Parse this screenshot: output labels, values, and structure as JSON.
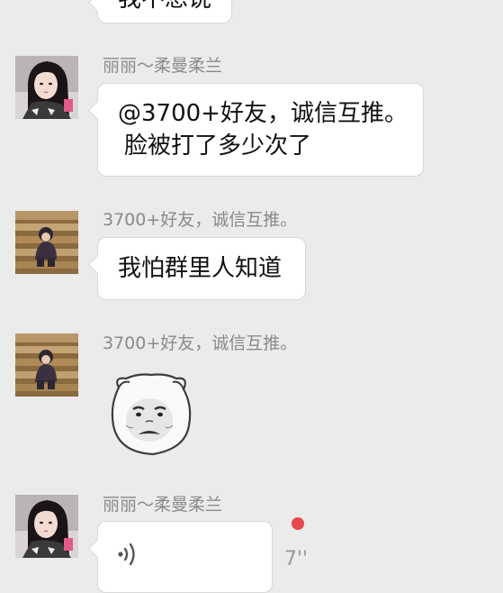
{
  "chat": {
    "messages": [
      {
        "type": "text",
        "lines": [
          "我不想说"
        ]
      },
      {
        "type": "text",
        "sender": "丽丽～柔曼柔兰",
        "avatar_icon": "girl-avatar-icon",
        "lines": [
          "@3700+好友，诚信互推。",
          "脸被打了多少次了"
        ]
      },
      {
        "type": "text",
        "sender": "3700+好友，诚信互推。",
        "avatar_icon": "child-on-stairs-avatar-icon",
        "lines": [
          "我怕群里人知道"
        ]
      },
      {
        "type": "sticker",
        "sender": "3700+好友，诚信互推。",
        "avatar_icon": "child-on-stairs-avatar-icon",
        "sticker_icon": "pouting-cat-face-icon"
      },
      {
        "type": "voice",
        "sender": "丽丽～柔曼柔兰",
        "avatar_icon": "girl-avatar-icon",
        "voice_icon": "voice-wave-icon",
        "duration": "7''",
        "unread": true
      }
    ]
  },
  "colors": {
    "background": "#ebebeb",
    "bubble": "#ffffff",
    "sender_text": "#8a8a8a",
    "unread_dot": "#e5484d"
  }
}
